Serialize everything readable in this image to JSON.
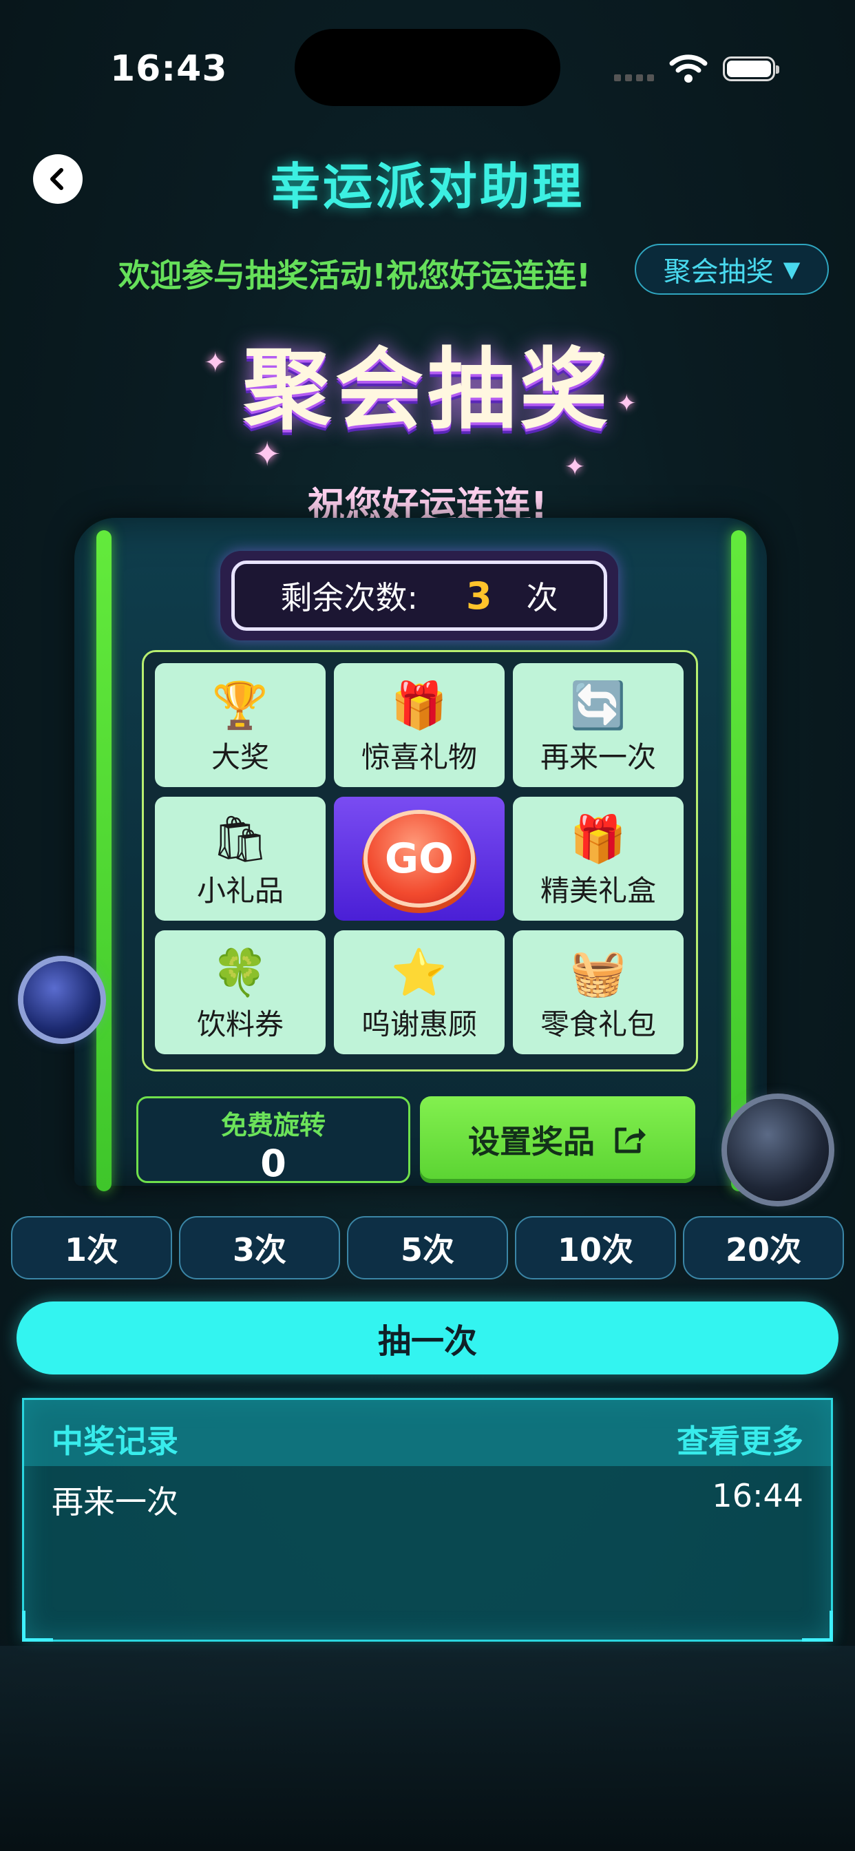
{
  "status_bar": {
    "time": "16:43"
  },
  "header": {
    "title": "幸运派对助理"
  },
  "welcome_text": "欢迎参与抽奖活动!祝您好运连连!",
  "mode_select": {
    "value": "聚会抽奖",
    "caret": "▼"
  },
  "banner": {
    "title": "聚会抽奖",
    "subtitle": "祝您好运连连!"
  },
  "counter": {
    "label": "剩余次数:",
    "value": "3",
    "unit": "次"
  },
  "grid": {
    "cells": [
      {
        "label": "大奖",
        "icon": "🏆"
      },
      {
        "label": "惊喜礼物",
        "icon": "🎁"
      },
      {
        "label": "再来一次",
        "icon": "🔄"
      },
      {
        "label": "小礼品",
        "icon": "🛍"
      },
      {
        "label": "GO",
        "icon": "go-button"
      },
      {
        "label": "精美礼盒",
        "icon": "🎁"
      },
      {
        "label": "饮料券",
        "icon": "🍀"
      },
      {
        "label": "呜谢惠顾",
        "icon": "⭐"
      },
      {
        "label": "零食礼包",
        "icon": "🧺"
      }
    ]
  },
  "free_spins": {
    "label": "免费旋转",
    "value": "0"
  },
  "prize_button": {
    "label": "设置奖品"
  },
  "count_options": [
    "1次",
    "3次",
    "5次",
    "10次",
    "20次"
  ],
  "draw_button": {
    "label": "抽一次"
  },
  "records": {
    "title": "中奖记录",
    "more": "查看更多",
    "items": [
      {
        "prize": "再来一次",
        "time": "16:44"
      }
    ]
  },
  "colors": {
    "accent_cyan": "#33f4f0",
    "accent_green": "#63ea3c",
    "title_cyan": "#3cf0e2"
  }
}
